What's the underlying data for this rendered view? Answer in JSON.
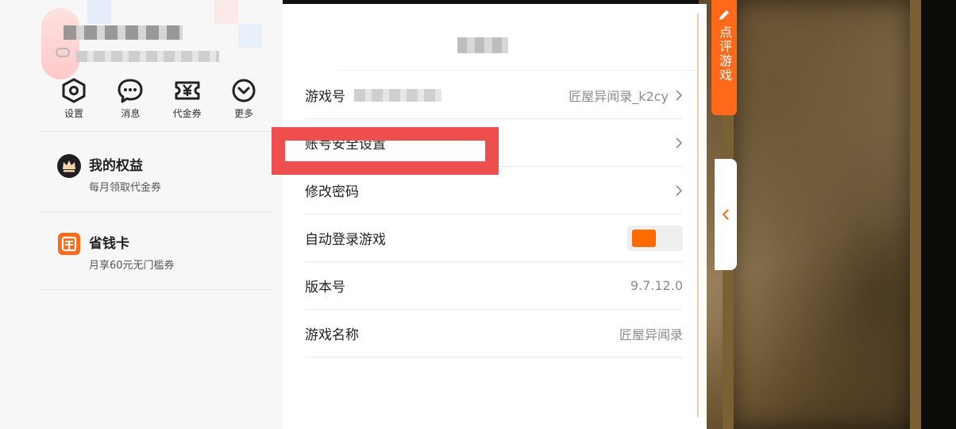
{
  "quick_actions": [
    {
      "label": "设置",
      "icon": "hexagon-settings-icon"
    },
    {
      "label": "消息",
      "icon": "chat-bubble-icon"
    },
    {
      "label": "代金券",
      "icon": "voucher-yen-icon"
    },
    {
      "label": "更多",
      "icon": "chevron-circle-icon"
    }
  ],
  "perks": [
    {
      "title": "我的权益",
      "subtitle": "每月领取代金券",
      "icon": "crown-icon"
    },
    {
      "title": "省钱卡",
      "subtitle": "月享60元无门槛券",
      "icon": "saving-card-icon"
    }
  ],
  "settings": {
    "rows": [
      {
        "label": "游戏号",
        "value": "匠屋异闻录_k2cy",
        "chevron": true
      },
      {
        "label": "账号安全设置",
        "value": "",
        "chevron": true
      },
      {
        "label": "修改密码",
        "value": "",
        "chevron": true
      },
      {
        "label": "自动登录游戏",
        "value": "",
        "toggle": true,
        "toggle_on": true
      },
      {
        "label": "版本号",
        "value": "9.7.12.0",
        "chevron": false
      },
      {
        "label": "游戏名称",
        "value": "匠屋异闻录",
        "chevron": false
      }
    ]
  },
  "side": {
    "review_tab_label": "点评游戏",
    "collapse_icon": "chevron-left-icon"
  },
  "colors": {
    "accent_orange": "#ff6a1a",
    "highlight_red": "#ee4e4e"
  }
}
